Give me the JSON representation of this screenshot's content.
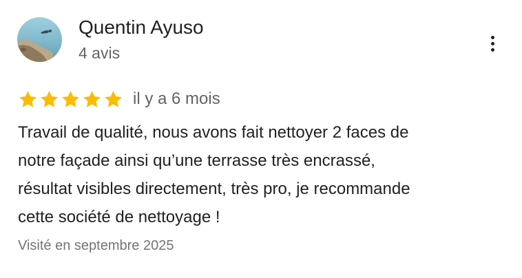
{
  "reviewer": {
    "name": "Quentin Ayuso",
    "review_count": "4 avis"
  },
  "review": {
    "rating": 5,
    "rating_max": 5,
    "relative_date": "il y a 6 mois",
    "text_lines": [
      "Travail de qualité, nous avons fait nettoyer 2 faces de",
      "notre façade ainsi qu’une terrasse très encrassé,",
      "résultat visibles directement, très pro, je recommande",
      "cette société de nettoyage !"
    ],
    "visit_info": "Visité en septembre 2025"
  },
  "icons": {
    "more": "more-vert-icon",
    "star": "star-icon"
  },
  "colors": {
    "star": "#fbbc04",
    "primary_text": "#202124",
    "secondary_text": "#5f6368"
  }
}
